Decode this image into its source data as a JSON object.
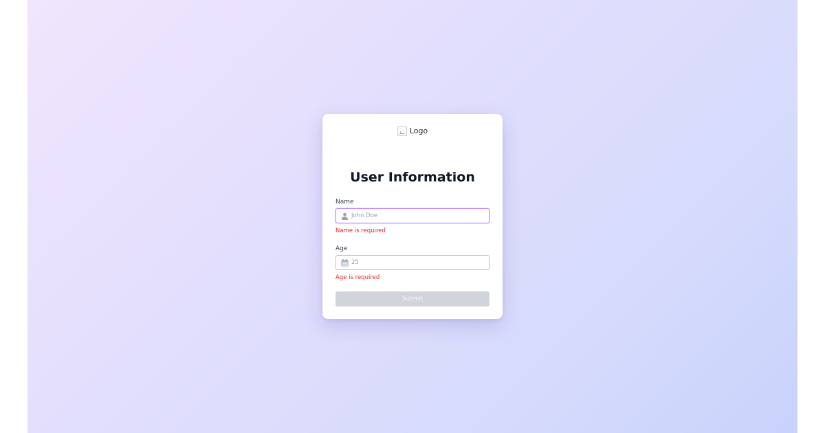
{
  "logo": {
    "alt": "Logo"
  },
  "form": {
    "title": "User Information",
    "name": {
      "label": "Name",
      "value": "",
      "placeholder": "John Doe",
      "icon": "user-icon",
      "error": "Name is required"
    },
    "age": {
      "label": "Age",
      "value": "",
      "placeholder": "25",
      "icon": "calendar-icon",
      "error": "Age is required"
    },
    "submit_label": "Submit",
    "submit_disabled": true
  },
  "colors": {
    "background_start": "#f0e6fd",
    "background_end": "#c8d2fb",
    "error": "#dc2626",
    "focus_border": "#c084fc",
    "error_border": "#fca5a5",
    "disabled_button": "#d1d5db"
  }
}
